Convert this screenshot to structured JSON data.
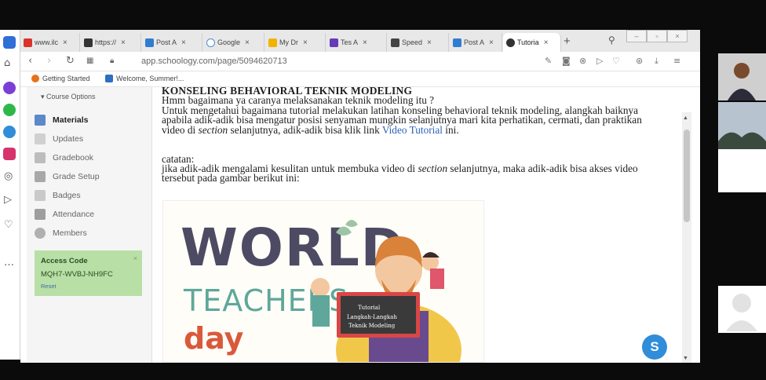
{
  "browser": {
    "tabs": [
      {
        "label": "www.ilc",
        "color": "#d9332b",
        "active": false
      },
      {
        "label": "https://",
        "color": "#333333",
        "active": false
      },
      {
        "label": "Post A",
        "color": "#2f7dd1",
        "active": false
      },
      {
        "label": "Google",
        "color": "#4a90d9",
        "active": false
      },
      {
        "label": "My Dr",
        "color": "#f2b300",
        "active": false
      },
      {
        "label": "Tes A",
        "color": "#673ab7",
        "active": false
      },
      {
        "label": "Speed",
        "color": "#444444",
        "active": false
      },
      {
        "label": "Post A",
        "color": "#2f7dd1",
        "active": false
      },
      {
        "label": "Tutoria",
        "color": "#333333",
        "active": true
      }
    ],
    "new_tab_symbol": "+",
    "url": "app.schoology.com/page/5094620713",
    "bookmarks": [
      {
        "label": "Getting Started",
        "color": "#e8711a"
      },
      {
        "label": "Welcome, Summer!...",
        "color": "#2f6fc0"
      }
    ]
  },
  "sidebar": {
    "course_options": "Course Options",
    "items": [
      {
        "label": "Materials",
        "icon": "materials-icon",
        "active": true
      },
      {
        "label": "Updates",
        "icon": "updates-icon",
        "active": false
      },
      {
        "label": "Gradebook",
        "icon": "gradebook-icon",
        "active": false
      },
      {
        "label": "Grade Setup",
        "icon": "grade-setup-icon",
        "active": false
      },
      {
        "label": "Badges",
        "icon": "badges-icon",
        "active": false
      },
      {
        "label": "Attendance",
        "icon": "attendance-icon",
        "active": false
      },
      {
        "label": "Members",
        "icon": "members-icon",
        "active": false
      }
    ],
    "access": {
      "title": "Access Code",
      "code": "MQH7-WVBJ-NH9FC",
      "reset": "Reset",
      "close": "×"
    }
  },
  "content": {
    "heading": "KONSELING BEHAVIORAL TEKNIK MODELING",
    "line1": "Hmm bagaimana ya caranya melaksanakan teknik modeling itu ?",
    "para2_pre": "Untuk mengetahui bagaimana tutorial melakukan latihan konseling behavioral teknik modeling, alangkah baiknya apabila adik-adik bisa mengatur posisi senyaman mungkin selanjutnya mari kita perhatikan, cermati, dan praktikan video di ",
    "para2_em": "section",
    "para2_mid": " selanjutnya, adik-adik bisa klik link ",
    "para2_link": "Video Tutorial",
    "para2_post": " ini.",
    "catatan": "catatan:",
    "para3_pre": "jika adik-adik mengalami kesulitan untuk membuka video di ",
    "para3_em": "section",
    "para3_post": " selanjutnya, maka adik-adik bisa akses video tersebut pada gambar berikut ini:"
  },
  "poster": {
    "word1": "WORLD",
    "word2": "TEACHERS",
    "word3": "day",
    "board_line1": "Tutorial",
    "board_line2": "Langkah-Langkah",
    "board_line3": "Teknik Modeling"
  },
  "floating_button": "S",
  "colors": {
    "accent": "#2f8dd9",
    "access_bg": "#b8e0a6",
    "link": "#2a62b8"
  }
}
